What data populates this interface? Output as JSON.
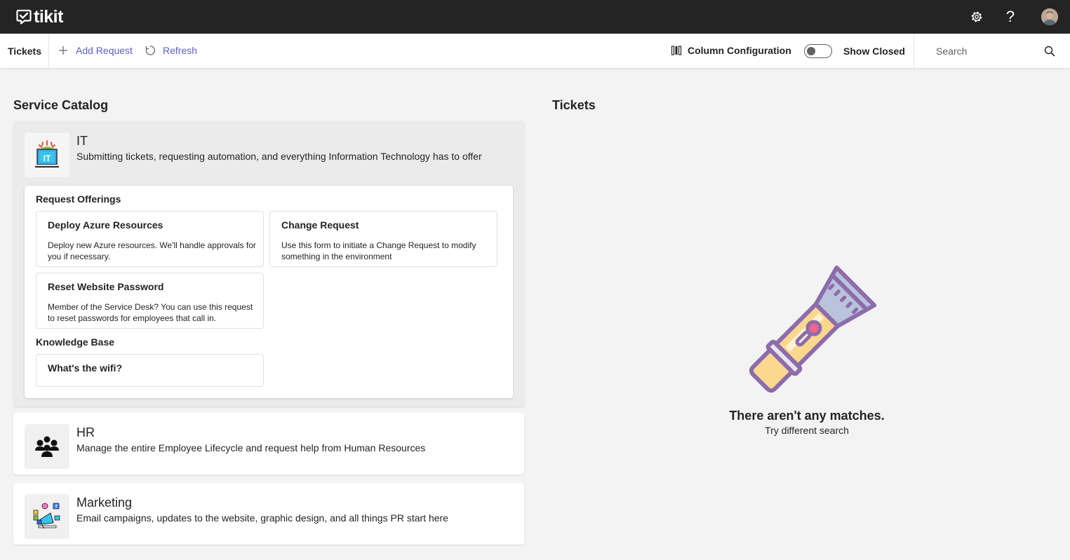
{
  "app": {
    "name": "tikit"
  },
  "header": {
    "icons": [
      "checkmark-logo-icon",
      "gear-icon",
      "help-icon",
      "avatar"
    ],
    "help_glyph": "?"
  },
  "toolbar": {
    "tab_label": "Tickets",
    "add_request": "Add Request",
    "refresh": "Refresh",
    "column_configuration": "Column Configuration",
    "show_closed": "Show Closed",
    "show_closed_on": false,
    "search_placeholder": "Search",
    "accent": "#5b5fc7"
  },
  "service_catalog": {
    "title": "Service Catalog",
    "categories": [
      {
        "title": "IT",
        "description": "Submitting tickets, requesting automation, and everything Information Technology has to offer",
        "expanded": true,
        "icon": "it-laptop-icon",
        "request_offerings_label": "Request Offerings",
        "offerings": [
          {
            "title": "Deploy Azure Resources",
            "description": "Deploy new Azure resources. We'll handle approvals for you if necessary."
          },
          {
            "title": "Change Request",
            "description": "Use this form to initiate a Change Request to modify something in the environment"
          },
          {
            "title": "Reset Website Password",
            "description": "Member of the Service Desk? You can use this request to reset passwords for employees that call in."
          }
        ],
        "knowledge_base_label": "Knowledge Base",
        "articles": [
          {
            "title": "What's the wifi?"
          }
        ]
      },
      {
        "title": "HR",
        "description": "Manage the entire Employee Lifecycle and request help from Human Resources",
        "expanded": false,
        "icon": "people-group-icon"
      },
      {
        "title": "Marketing",
        "description": "Email campaigns, updates to the website, graphic design, and all things PR start here",
        "expanded": false,
        "icon": "marketing-megaphone-icon"
      }
    ]
  },
  "tickets": {
    "title": "Tickets",
    "empty_title": "There aren't any matches.",
    "empty_subtitle": "Try different search",
    "empty_icon": "flashlight-icon"
  }
}
